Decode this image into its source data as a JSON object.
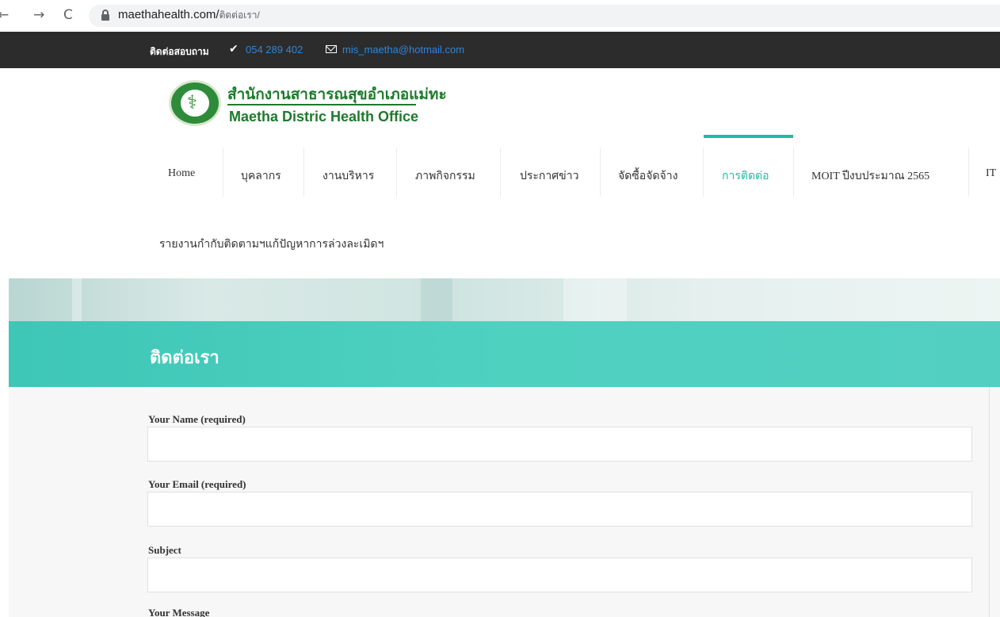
{
  "browser": {
    "back_icon": "←",
    "forward_icon": "→",
    "reload_icon": "C",
    "url_domain": "maethahealth.com/",
    "url_path": "ติดต่อเรา/"
  },
  "topbar": {
    "contact_label": "ติดต่อสอบถาม",
    "phone_icon": "✔",
    "phone": "054 289 402",
    "email": "mis_maetha@hotmail.com"
  },
  "logo": {
    "thai_name": "สำนักงานสาธารณสุขอำเภอแม่ทะ",
    "english_name": "Maetha Distric Health Office"
  },
  "nav": {
    "items": [
      {
        "label": "Home"
      },
      {
        "label": "บุคลากร"
      },
      {
        "label": "งานบริหาร"
      },
      {
        "label": "ภาพกิจกรรม"
      },
      {
        "label": "ประกาศข่าว"
      },
      {
        "label": "จัดซื้อจัดจ้าง"
      },
      {
        "label": "การติดต่อ"
      },
      {
        "label": "MOIT ปีงบประมาณ 2565"
      },
      {
        "label": "IT"
      }
    ],
    "second_row": "รายงานกำกับติดตามฯแก้ปัญหาการล่วงละเมิดฯ",
    "active_color": "#1fbba6"
  },
  "page": {
    "title": "ติดต่อเรา",
    "band_color": "#4fd1c0"
  },
  "form": {
    "name_label": "Your Name (required)",
    "name_value": "",
    "email_label": "Your Email (required)",
    "email_value": "",
    "subject_label": "Subject",
    "subject_value": "",
    "message_label": "Your Message"
  }
}
